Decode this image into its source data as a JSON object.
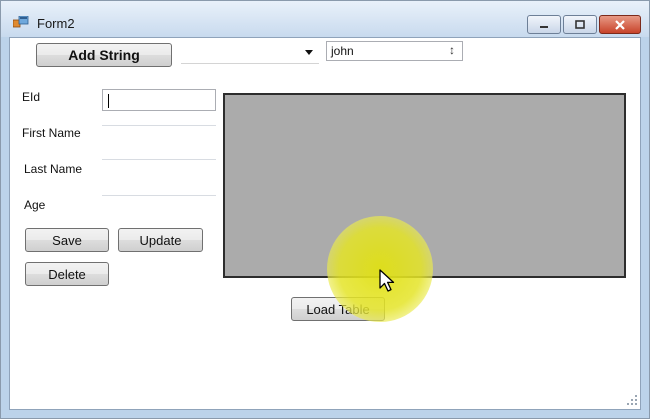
{
  "window": {
    "title": "Form2",
    "icon": "winforms-app-icon",
    "controls": [
      "minimize-icon",
      "maximize-icon",
      "close-icon"
    ]
  },
  "toolbar": {
    "add_string_label": "Add String",
    "combo_value": "",
    "name_input_value": "john"
  },
  "form": {
    "eid_label": "EId",
    "eid_value": "",
    "first_name_label": "First Name",
    "first_name_value": "",
    "last_name_label": "Last Name",
    "last_name_value": "",
    "age_label": "Age",
    "age_value": ""
  },
  "buttons": {
    "save": "Save",
    "update": "Update",
    "delete": "Delete",
    "load_table": "Load Table"
  },
  "colors": {
    "grid_background": "#ababab",
    "cursor_highlight": "#e4e428"
  }
}
